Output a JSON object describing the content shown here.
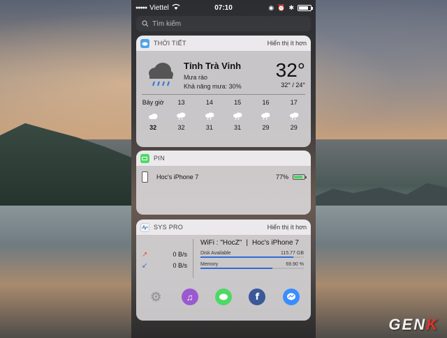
{
  "status_bar": {
    "carrier": "Viettel",
    "time": "07:10"
  },
  "search": {
    "placeholder": "Tìm kiếm"
  },
  "weather_widget": {
    "title": "THỜI TIẾT",
    "toggle_label": "Hiển thị ít hơn",
    "city": "Tỉnh Trà Vinh",
    "condition": "Mưa rào",
    "rain_chance": "Khả năng mưa: 30%",
    "current_temp": "32°",
    "high_low": "32° / 24°",
    "hourly": [
      {
        "label": "Bây giờ",
        "temp": "32",
        "icon": "cloud-icon"
      },
      {
        "label": "13",
        "temp": "32",
        "icon": "rain-cloud-icon"
      },
      {
        "label": "14",
        "temp": "31",
        "icon": "rain-cloud-icon"
      },
      {
        "label": "15",
        "temp": "31",
        "icon": "rain-cloud-icon"
      },
      {
        "label": "16",
        "temp": "29",
        "icon": "rain-cloud-icon"
      },
      {
        "label": "17",
        "temp": "29",
        "icon": "rain-cloud-icon"
      }
    ]
  },
  "battery_widget": {
    "title": "PIN",
    "device_name": "Hoc's iPhone 7",
    "percent": "77%",
    "level": 0.77,
    "bar_color": "#4cd964"
  },
  "sys_widget": {
    "title": "SYS PRO",
    "toggle_label": "Hiển thị ít hơn",
    "upload_speed": "0 B/s",
    "download_speed": "0 B/s",
    "wifi_line": "WiFi : \"HocZ\"",
    "separator": "|",
    "device_line": "Hoc's iPhone 7",
    "disk_label": "Disk Available",
    "disk_value": "115.77 GB",
    "disk_level": 0.9,
    "memory_label": "Memory",
    "memory_value": "69.90 %",
    "memory_level": 0.699,
    "dock": [
      {
        "name": "settings",
        "color": "#9a999b"
      },
      {
        "name": "music",
        "color": "#9b59d0"
      },
      {
        "name": "messages",
        "color": "#4cd964"
      },
      {
        "name": "facebook",
        "color": "#3b5998"
      },
      {
        "name": "messenger",
        "color": "#3a8dff"
      }
    ]
  },
  "watermark": {
    "text_a": "GEN",
    "text_b": "K"
  }
}
